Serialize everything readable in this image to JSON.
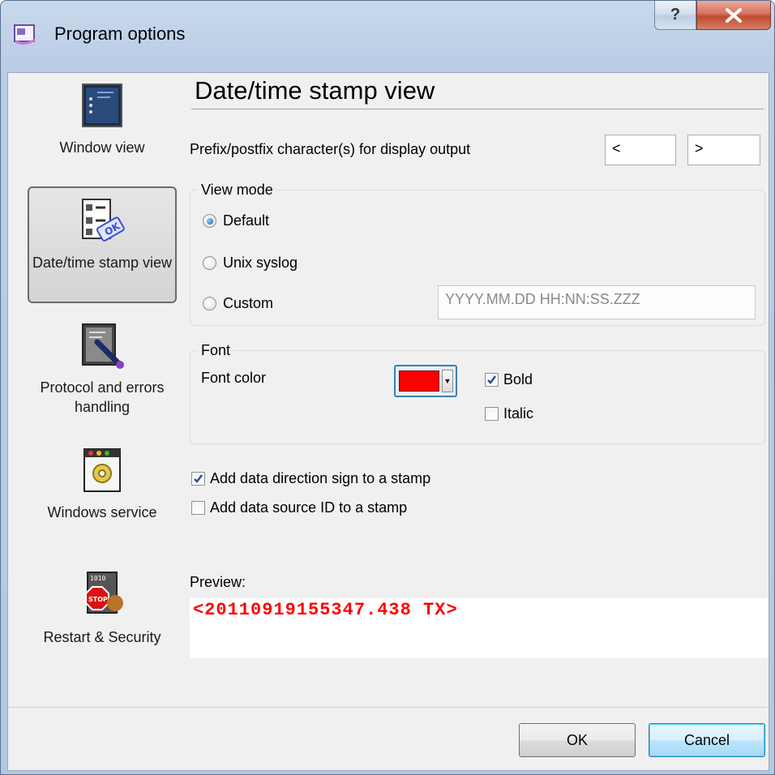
{
  "window": {
    "title": "Program options",
    "help_glyph": "?",
    "close_glyph": "X"
  },
  "sidebar": {
    "items": [
      {
        "label": "Window view",
        "icon": "window-view-icon"
      },
      {
        "label": "Date/time stamp view",
        "icon": "datetime-stamp-icon",
        "selected": true
      },
      {
        "label": "Protocol and errors handling",
        "icon": "protocol-errors-icon"
      },
      {
        "label": "Windows service",
        "icon": "windows-service-icon"
      },
      {
        "label": "Restart & Security",
        "icon": "restart-security-icon"
      }
    ]
  },
  "page": {
    "heading": "Date/time stamp view",
    "prefix_label": "Prefix/postfix character(s) for display output",
    "prefix_value": "<",
    "postfix_value": ">"
  },
  "view_mode": {
    "title": "View mode",
    "options": [
      "Default",
      "Unix syslog",
      "Custom"
    ],
    "selected": "Default",
    "custom_format": "YYYY.MM.DD HH:NN:SS.ZZZ"
  },
  "font": {
    "title": "Font",
    "color_label": "Font color",
    "color_value": "#ff0000",
    "bold_label": "Bold",
    "bold_checked": true,
    "italic_label": "Italic",
    "italic_checked": false
  },
  "options": {
    "direction_sign_label": "Add data direction sign to a stamp",
    "direction_sign_checked": true,
    "source_id_label": "Add data source ID to a stamp",
    "source_id_checked": false
  },
  "preview": {
    "label": "Preview:",
    "text": "<20110919155347.438 TX>"
  },
  "buttons": {
    "ok": "OK",
    "cancel": "Cancel"
  }
}
